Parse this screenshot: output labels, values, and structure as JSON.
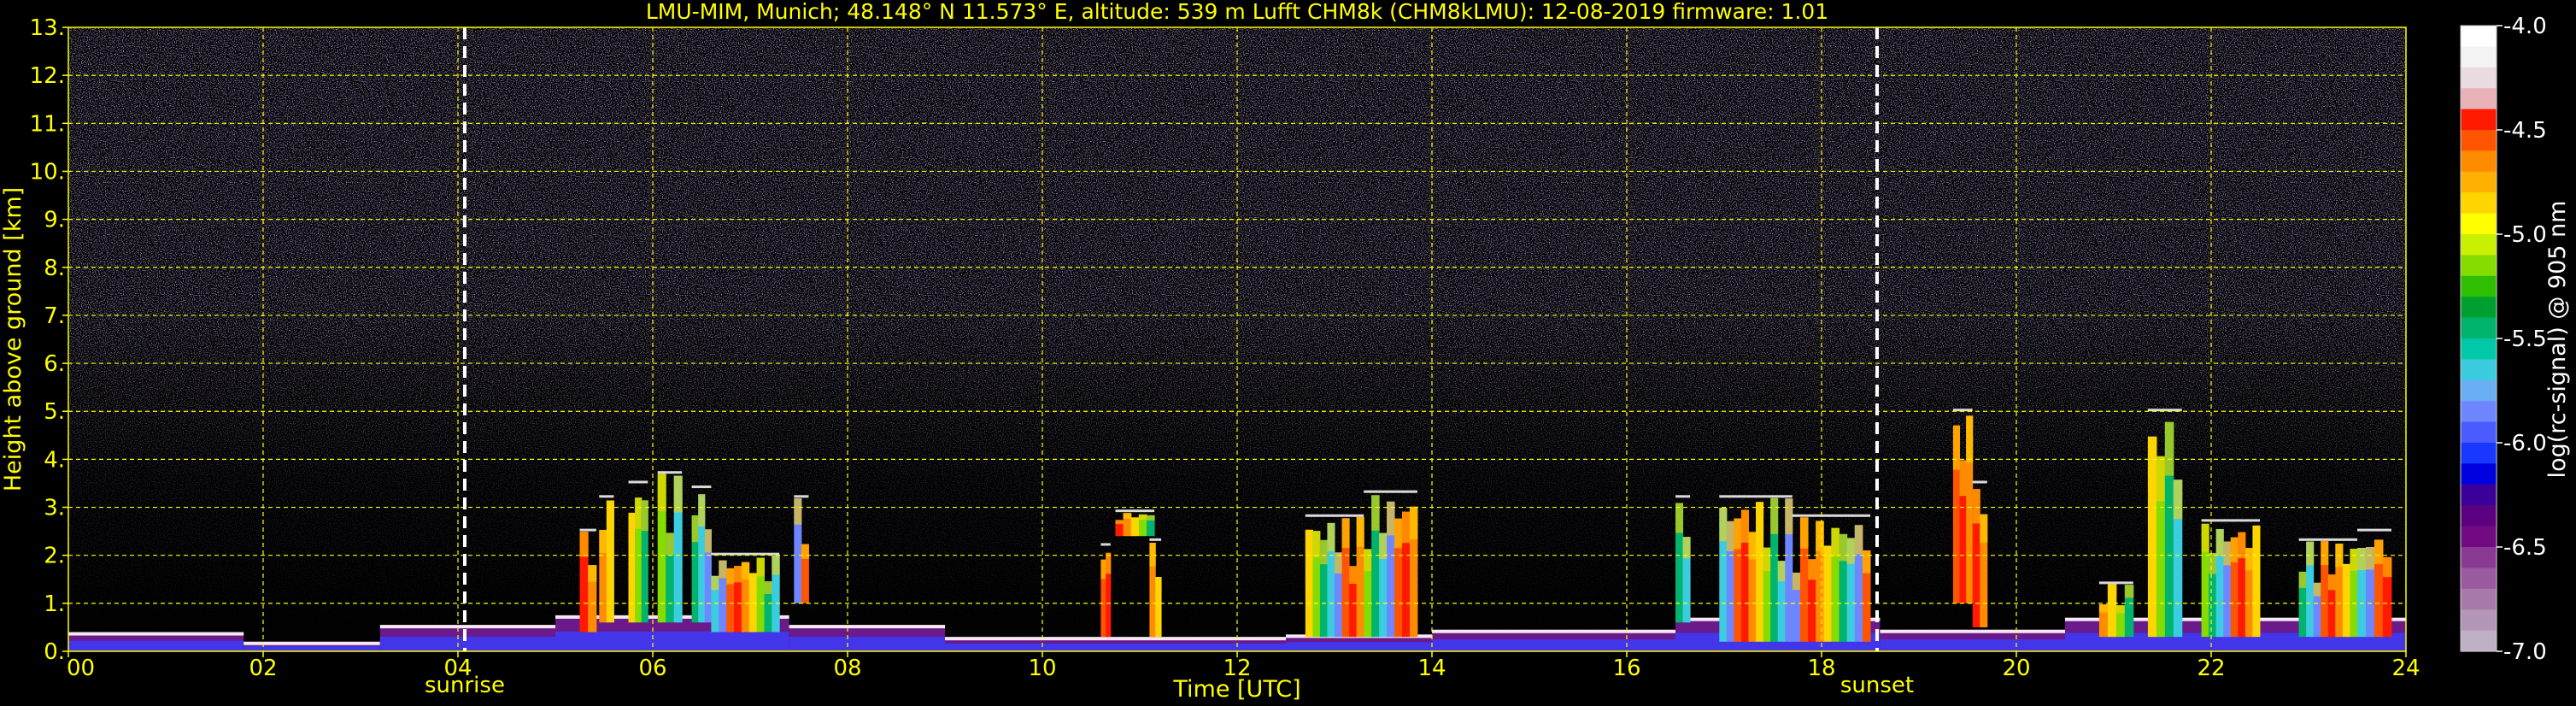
{
  "chart_data": {
    "type": "heatmap",
    "title": "LMU-MIM, Munich; 48.148° N 11.573° E, altitude: 539 m    Lufft CHM8k (CHM8kLMU): 12-08-2019    firmware: 1.01",
    "xlabel": "Time [UTC]",
    "ylabel": "Height above ground [km]",
    "xlim": [
      0,
      24
    ],
    "ylim": [
      0,
      13
    ],
    "x_ticks": [
      "00",
      "02",
      "04",
      "06",
      "08",
      "10",
      "12",
      "14",
      "16",
      "18",
      "20",
      "22",
      "24"
    ],
    "y_ticks": [
      "0.",
      "1.",
      "2.",
      "3.",
      "4.",
      "5.",
      "6.",
      "7.",
      "8.",
      "9.",
      "10.",
      "11.",
      "12.",
      "13."
    ],
    "grid": true,
    "events": [
      {
        "label": "sunrise",
        "time": 4.07
      },
      {
        "label": "sunset",
        "time": 18.57
      }
    ],
    "colorbar": {
      "label": "log(rc-signal) @ 905 nm",
      "range": [
        -7.0,
        -4.0
      ],
      "ticks": [
        "-4.0",
        "-4.5",
        "-5.0",
        "-5.5",
        "-6.0",
        "-6.5",
        "-7.0"
      ],
      "colors": [
        "#ffffff",
        "#f3f3f3",
        "#eadbe0",
        "#e8b2b8",
        "#ff1a00",
        "#ff5500",
        "#ff8c00",
        "#ffb000",
        "#ffd500",
        "#ffff00",
        "#c8f000",
        "#86dc00",
        "#2ec000",
        "#00a030",
        "#00b46e",
        "#00c8a8",
        "#3ccce0",
        "#6aaef5",
        "#6e86ff",
        "#4a5cff",
        "#1838ff",
        "#0000e0",
        "#3a0099",
        "#5a0080",
        "#720a82",
        "#8a3a92",
        "#9a5aa0",
        "#a87aac",
        "#b496b8",
        "#bfb0c6"
      ]
    },
    "cloud_layers": [
      {
        "start": 5.25,
        "end": 5.42,
        "base": 0.4,
        "top": 2.5
      },
      {
        "start": 5.45,
        "end": 5.6,
        "base": 0.6,
        "top": 3.2
      },
      {
        "start": 5.75,
        "end": 5.95,
        "base": 0.6,
        "top": 3.5
      },
      {
        "start": 6.05,
        "end": 6.3,
        "base": 0.6,
        "top": 3.7
      },
      {
        "start": 6.4,
        "end": 6.6,
        "base": 0.6,
        "top": 3.4
      },
      {
        "start": 6.6,
        "end": 7.3,
        "base": 0.4,
        "top": 2.0
      },
      {
        "start": 7.45,
        "end": 7.6,
        "base": 1.0,
        "top": 3.2
      },
      {
        "start": 10.6,
        "end": 10.7,
        "base": 0.3,
        "top": 2.2
      },
      {
        "start": 10.75,
        "end": 11.15,
        "base": 2.4,
        "top": 2.9
      },
      {
        "start": 11.1,
        "end": 11.22,
        "base": 0.3,
        "top": 2.3
      },
      {
        "start": 12.7,
        "end": 13.3,
        "base": 0.3,
        "top": 2.8
      },
      {
        "start": 13.3,
        "end": 13.85,
        "base": 0.3,
        "top": 3.3
      },
      {
        "start": 16.5,
        "end": 16.65,
        "base": 0.6,
        "top": 3.2
      },
      {
        "start": 16.95,
        "end": 17.7,
        "base": 0.2,
        "top": 3.2
      },
      {
        "start": 17.7,
        "end": 18.5,
        "base": 0.2,
        "top": 2.8
      },
      {
        "start": 19.35,
        "end": 19.55,
        "base": 1.0,
        "top": 5.0
      },
      {
        "start": 19.55,
        "end": 19.7,
        "base": 0.5,
        "top": 3.5
      },
      {
        "start": 20.85,
        "end": 21.2,
        "base": 0.3,
        "top": 1.4
      },
      {
        "start": 21.35,
        "end": 21.7,
        "base": 0.3,
        "top": 5.0
      },
      {
        "start": 21.9,
        "end": 22.5,
        "base": 0.3,
        "top": 2.7
      },
      {
        "start": 22.9,
        "end": 23.5,
        "base": 0.3,
        "top": 2.3
      },
      {
        "start": 23.5,
        "end": 23.85,
        "base": 0.3,
        "top": 2.5
      }
    ],
    "aerosol_layers": [
      {
        "start": 0.0,
        "end": 1.8,
        "base": 0.0,
        "top": 0.4
      },
      {
        "start": 1.8,
        "end": 3.2,
        "base": 0.0,
        "top": 0.2
      },
      {
        "start": 3.2,
        "end": 5.0,
        "base": 0.0,
        "top": 0.55
      },
      {
        "start": 5.0,
        "end": 7.4,
        "base": 0.0,
        "top": 0.75
      },
      {
        "start": 7.4,
        "end": 9.0,
        "base": 0.0,
        "top": 0.55
      },
      {
        "start": 9.0,
        "end": 12.5,
        "base": 0.0,
        "top": 0.3
      },
      {
        "start": 12.5,
        "end": 14.0,
        "base": 0.0,
        "top": 0.35
      },
      {
        "start": 14.0,
        "end": 16.5,
        "base": 0.0,
        "top": 0.45
      },
      {
        "start": 16.5,
        "end": 18.6,
        "base": 0.0,
        "top": 0.7
      },
      {
        "start": 18.6,
        "end": 20.5,
        "base": 0.0,
        "top": 0.45
      },
      {
        "start": 20.5,
        "end": 24.0,
        "base": 0.0,
        "top": 0.7
      }
    ]
  }
}
